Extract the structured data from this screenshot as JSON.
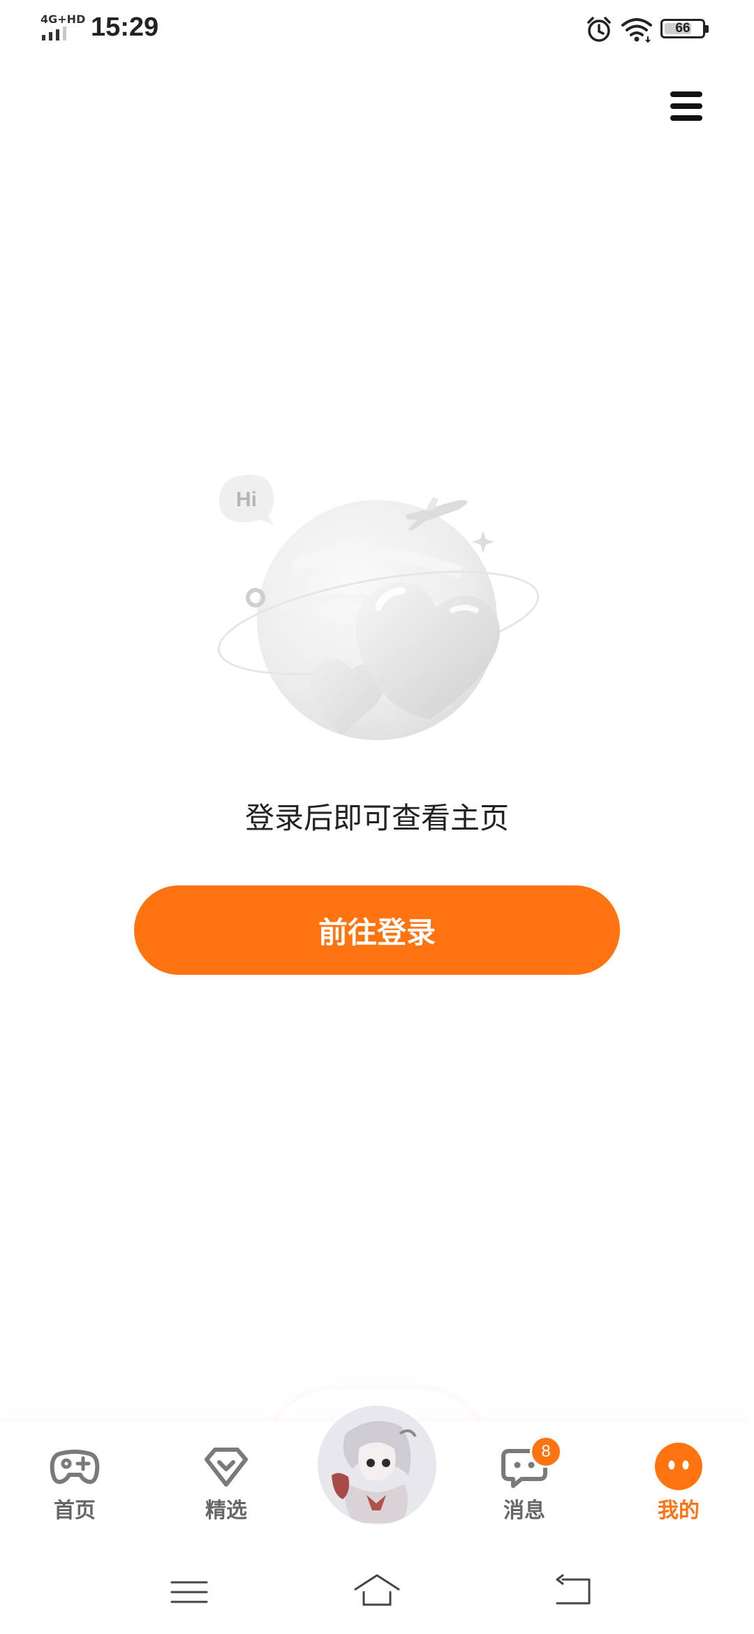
{
  "status_bar": {
    "network": "4G+HD",
    "time": "15:29",
    "battery": "66",
    "battery_level": 0.66
  },
  "main": {
    "prompt": "登录后即可查看主页",
    "login_button": "前往登录",
    "illustration_bubble": "Hi"
  },
  "tab_bar": {
    "items": [
      {
        "label": "首页",
        "icon": "gamepad-icon"
      },
      {
        "label": "精选",
        "icon": "heart-gem-icon"
      },
      {
        "label": "",
        "icon": "avatar"
      },
      {
        "label": "消息",
        "icon": "chat-icon",
        "badge": "8"
      },
      {
        "label": "我的",
        "icon": "face-icon",
        "active": true
      }
    ]
  },
  "colors": {
    "accent": "#ff7311",
    "inactive": "#666666"
  }
}
